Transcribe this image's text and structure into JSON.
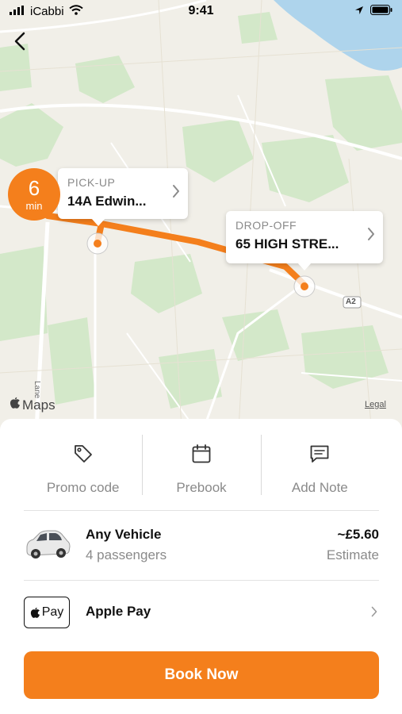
{
  "status_bar": {
    "carrier": "iCabbi",
    "time": "9:41"
  },
  "map": {
    "eta": {
      "value": "6",
      "unit": "min"
    },
    "pickup": {
      "label": "PICK-UP",
      "address": "14A Edwin..."
    },
    "dropoff": {
      "label": "DROP-OFF",
      "address": "65 HIGH STRE..."
    },
    "road_label": "A2",
    "street_label": "Lane",
    "provider": "Maps",
    "legal": "Legal",
    "route_color": "#f47f1c"
  },
  "options": [
    {
      "label": "Promo code",
      "icon": "tag-icon"
    },
    {
      "label": "Prebook",
      "icon": "calendar-icon"
    },
    {
      "label": "Add Note",
      "icon": "note-icon"
    }
  ],
  "vehicle": {
    "name": "Any Vehicle",
    "passengers": "4 passengers",
    "price": "~£5.60",
    "price_note": "Estimate",
    "icon": "car-icon"
  },
  "payment": {
    "badge": "Pay",
    "name": "Apple Pay",
    "icon": "apple-pay-icon"
  },
  "book_button": "Book Now",
  "colors": {
    "accent": "#f47f1c",
    "water": "#aed4ec",
    "map_bg": "#f1efe8",
    "park": "#d3e8c9"
  }
}
